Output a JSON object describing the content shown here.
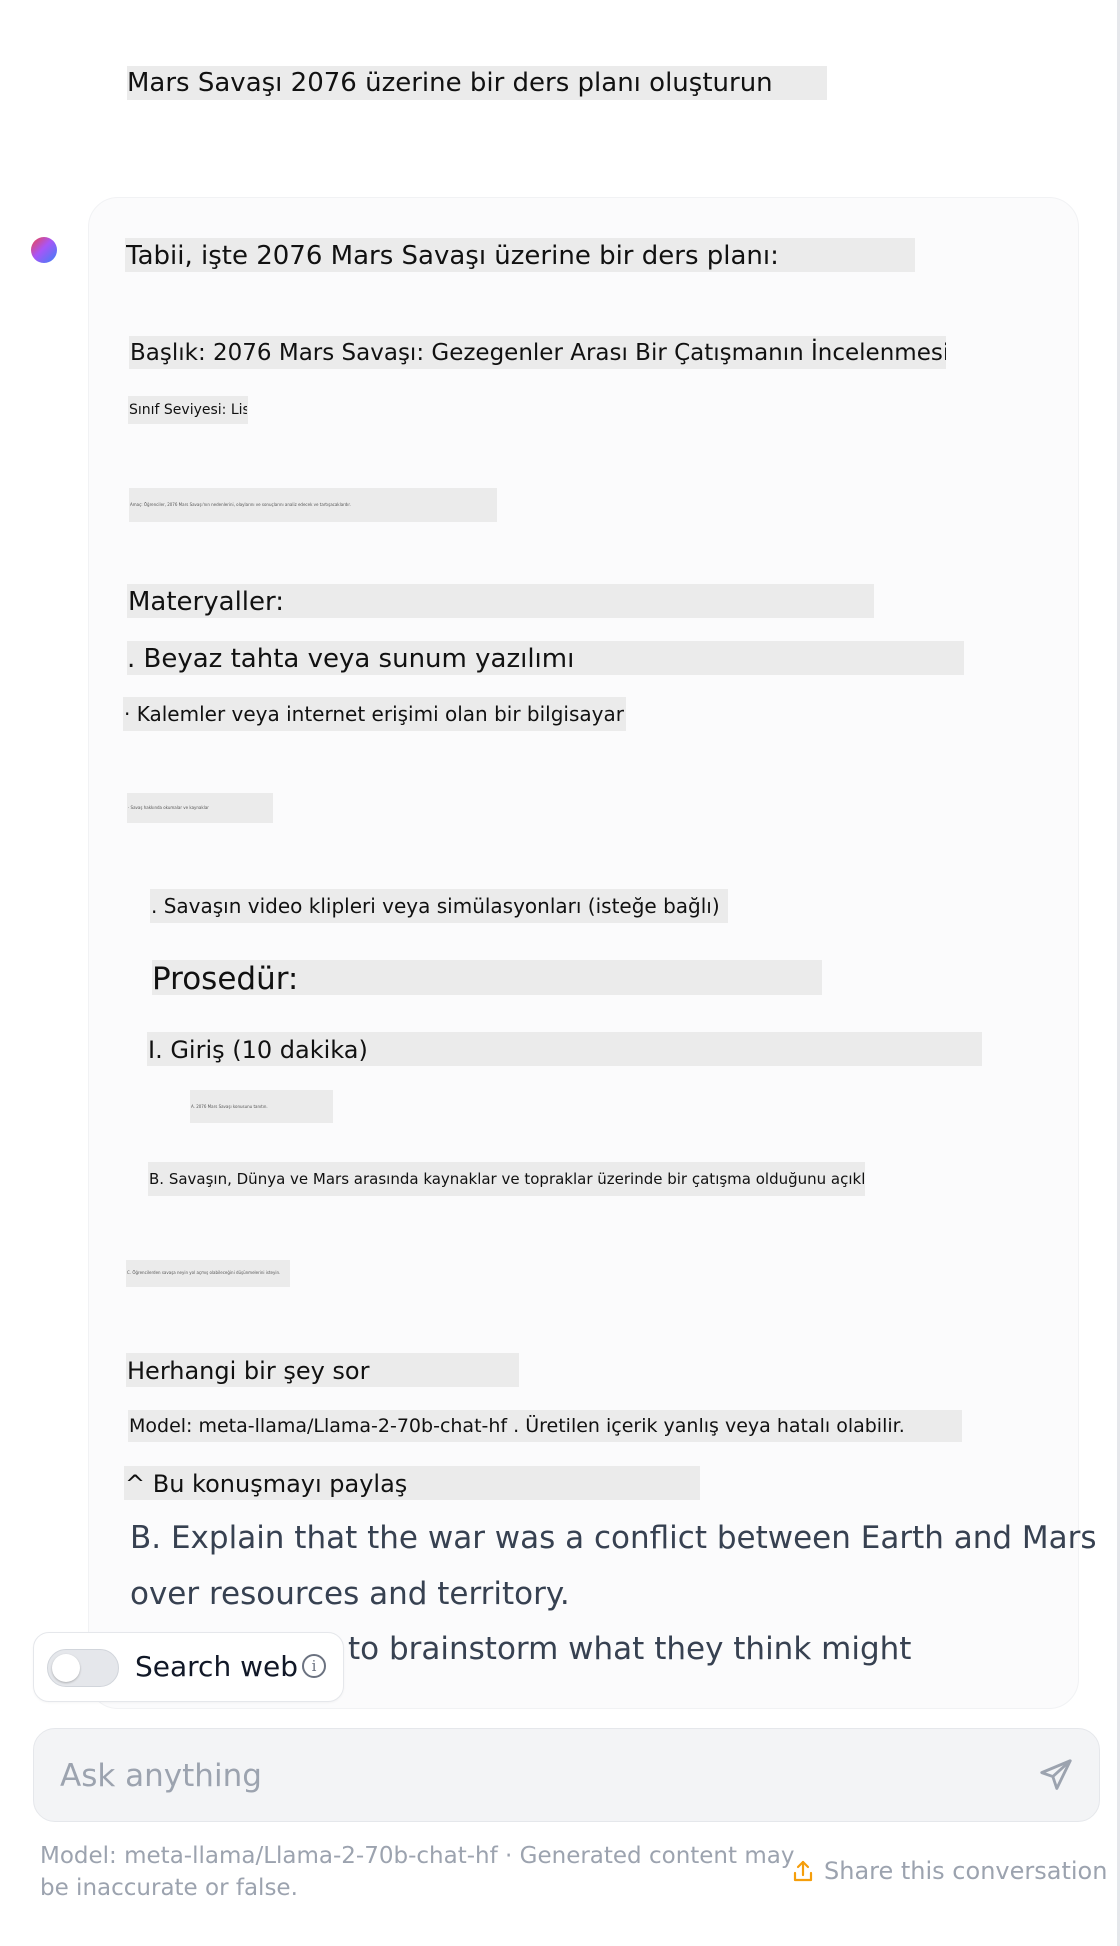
{
  "conversation": {
    "user_prompt": "Mars Savaşı 2076 üzerine bir ders planı oluşturun",
    "response": {
      "intro": "Tabii, işte 2076 Mars Savaşı üzerine bir ders planı:",
      "title_line": "Başlık: 2076 Mars Savaşı: Gezegenler Arası Bir Çatışmanın İncelenmesi",
      "grade_line": "Sınıf Seviyesi: Lise",
      "objective_line": "Amaç: Öğrenciler, 2076 Mars Savaşı'nın nedenlerini, olaylarını ve sonuçlarını analiz edecek ve tartışacaklardır.",
      "materials_heading": "Materyaller:",
      "material_1": ". Beyaz tahta veya sunum yazılımı",
      "material_2": "· Kalemler veya internet erişimi olan bir bilgisayar",
      "material_3": "· Savaş hakkında okumalar ve kaynaklar",
      "material_4": ". Savaşın video klipleri veya simülasyonları (isteğe bağlı)",
      "procedure_heading": "Prosedür:",
      "intro_section": "I. Giriş (10 dakika)",
      "step_a": "A. 2076 Mars Savaşı konusunu tanıtın.",
      "step_b": "B. Savaşın, Dünya ve Mars arasında kaynaklar ve topraklar üzerinde bir çatışma olduğunu açıklayın.",
      "step_c": "C. Öğrencilerden savaşa neyin yol açmış olabileceğini düşünmelerini isteyin."
    },
    "overlay_tr": {
      "ask_placeholder": "Herhangi bir şey sor",
      "model_note": "Model: meta-llama/Llama-2-70b-chat-hf . Üretilen içerik yanlış veya hatalı olabilir.",
      "share": "^ Bu konuşmayı paylaş"
    },
    "overlay_en": {
      "line_1": "B. Explain that the war was a conflict between Earth and Mars",
      "line_2": "over resources and territory.",
      "line_3": "s to brainstorm what they think might"
    }
  },
  "search_toggle": {
    "label": "Search web",
    "enabled": false
  },
  "composer": {
    "placeholder": "Ask anything"
  },
  "footer": {
    "model_note": "Model: meta-llama/Llama-2-70b-chat-hf · Generated content may be inaccurate or false.",
    "share_label": "Share this conversation"
  },
  "icons": {
    "info": "info-icon",
    "send": "send-icon",
    "share": "share-icon",
    "avatar": "assistant-avatar"
  },
  "colors": {
    "highlight": "#ebebeb",
    "muted_text": "#9ca3af",
    "share_icon": "#f59e0b"
  }
}
